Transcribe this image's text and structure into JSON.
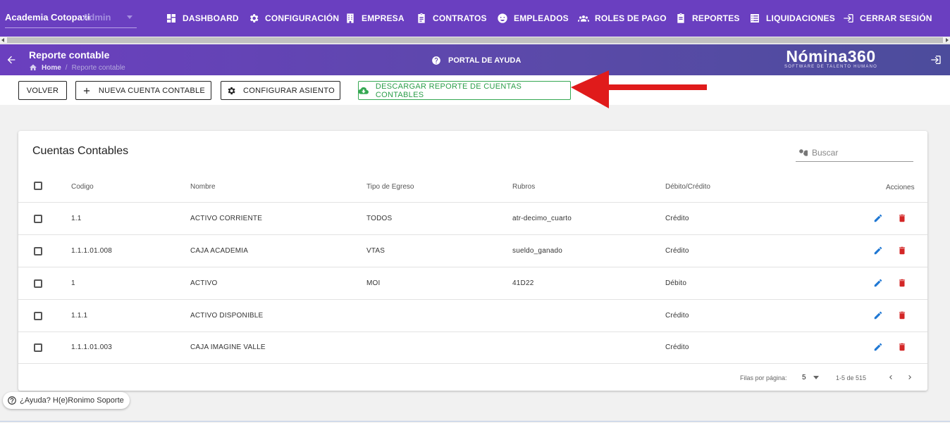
{
  "topnav": {
    "company": "Academia Cotopaxi",
    "role": "Admin",
    "items": [
      {
        "label": "DASHBOARD",
        "icon": "dashboard-icon"
      },
      {
        "label": "CONFIGURACIÓN",
        "icon": "gear-icon"
      },
      {
        "label": "EMPRESA",
        "icon": "building-icon"
      },
      {
        "label": "CONTRATOS",
        "icon": "clipboard-icon"
      },
      {
        "label": "EMPLEADOS",
        "icon": "face-icon"
      },
      {
        "label": "ROLES DE PAGO",
        "icon": "group-icon"
      },
      {
        "label": "REPORTES",
        "icon": "assignment-icon"
      },
      {
        "label": "LIQUIDACIONES",
        "icon": "list-icon"
      },
      {
        "label": "CERRAR SESIÓN",
        "icon": "logout-icon"
      }
    ]
  },
  "header": {
    "title": "Reporte contable",
    "breadcrumb": {
      "home": "Home",
      "current": "Reporte contable"
    },
    "help_label": "PORTAL DE AYUDA",
    "logo": {
      "main": "Nómina360",
      "tagline": "SOFTWARE DE TALENTO HUMANO"
    }
  },
  "toolbar": {
    "back_label": "VOLVER",
    "new_account_label": "NUEVA CUENTA CONTABLE",
    "configure_label": "CONFIGURAR ASIENTO",
    "download_label": "DESCARGAR REPORTE DE CUENTAS CONTABLES"
  },
  "table": {
    "title": "Cuentas Contables",
    "search_placeholder": "Buscar",
    "columns": {
      "code": "Codigo",
      "name": "Nombre",
      "type": "Tipo de Egreso",
      "items": "Rubros",
      "dc": "Débito/Crédito",
      "actions": "Acciones"
    },
    "rows": [
      {
        "code": "1.1",
        "name": "ACTIVO CORRIENTE",
        "type": "TODOS",
        "items": "atr-decimo_cuarto",
        "dc": "Crédito"
      },
      {
        "code": "1.1.1.01.008",
        "name": "CAJA ACADEMIA",
        "type": "VTAS",
        "items": "sueldo_ganado",
        "dc": "Crédito"
      },
      {
        "code": "1",
        "name": "ACTIVO",
        "type": "MOI",
        "items": "41D22",
        "dc": "Débito"
      },
      {
        "code": "1.1.1",
        "name": "ACTIVO DISPONIBLE",
        "type": "",
        "items": "",
        "dc": "Crédito"
      },
      {
        "code": "1.1.1.01.003",
        "name": "CAJA IMAGINE VALLE",
        "type": "",
        "items": "",
        "dc": "Crédito"
      }
    ],
    "footer": {
      "rows_per_page_label": "Filas por página:",
      "rows_per_page": "5",
      "range": "1-5 de 515"
    }
  },
  "help_chip": "¿Ayuda? H(e)Ronimo Soporte",
  "colors": {
    "primary": "#6a3fc0",
    "download": "#35a852",
    "edit": "#1e77d3",
    "delete": "#d32626",
    "annotation_arrow": "#e01b1b"
  }
}
